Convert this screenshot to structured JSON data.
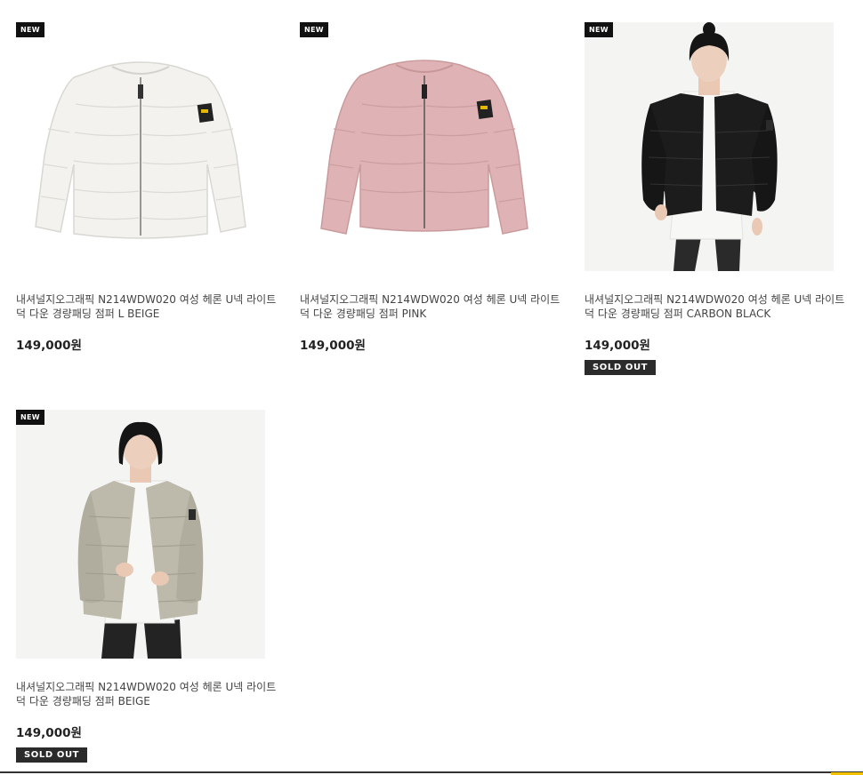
{
  "products": [
    {
      "badge": "NEW",
      "image_icon": "white-down-jacket",
      "name": "내셔널지오그래픽 N214WDW020 여성 헤론 U넥 라이트 덕 다운 경량패딩 점퍼 L BEIGE",
      "price": "149,000원",
      "sold_out": ""
    },
    {
      "badge": "NEW",
      "image_icon": "pink-down-jacket",
      "name": "내셔널지오그래픽 N214WDW020 여성 헤론 U넥 라이트 덕 다운 경량패딩 점퍼 PINK",
      "price": "149,000원",
      "sold_out": ""
    },
    {
      "badge": "NEW",
      "image_icon": "model-black-jacket",
      "name": "내셔널지오그래픽 N214WDW020 여성 헤론 U넥 라이트 덕 다운 경량패딩 점퍼 CARBON BLACK",
      "price": "149,000원",
      "sold_out": "SOLD OUT"
    },
    {
      "badge": "NEW",
      "image_icon": "model-beige-jacket",
      "name": "내셔널지오그래픽 N214WDW020 여성 헤론 U넥 라이트 덕 다운 경량패딩 점퍼 BEIGE",
      "price": "149,000원",
      "sold_out": "SOLD OUT"
    }
  ],
  "colors": {
    "badge_bg": "#111111",
    "badge_accent": "#f2c200",
    "soldout_bg": "#2b2b2b",
    "jacket_white": "#f3f2ee",
    "jacket_pink": "#dfb3b5",
    "jacket_black": "#1c1c1c",
    "jacket_beige": "#bdb9ab"
  }
}
